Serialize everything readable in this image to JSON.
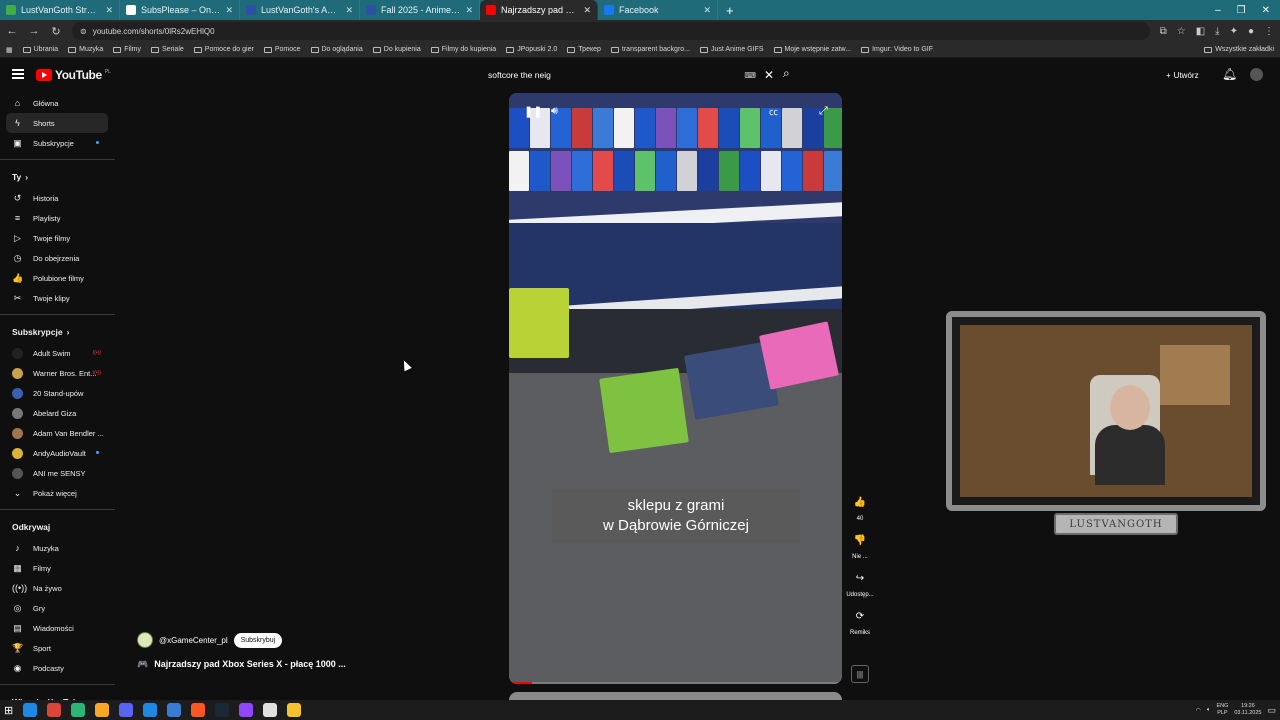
{
  "browser": {
    "tabs": [
      {
        "title": "LustVanGoth Stream - Watch L",
        "color": "#3fae49"
      },
      {
        "title": "SubsPlease – One stop shop fo",
        "color": "#ffffff"
      },
      {
        "title": "LustVanGoth's Anime List - My",
        "color": "#2e51a2"
      },
      {
        "title": "Fall 2025 - Anime - MyAnimeLi",
        "color": "#2e51a2"
      },
      {
        "title": "Najrzadszy pad Xbox Se",
        "color": "#ff0000",
        "active": true
      },
      {
        "title": "Facebook",
        "color": "#1877f2"
      }
    ],
    "new_tab": "+",
    "window_controls": [
      "–",
      "❐",
      "✕"
    ],
    "url": "youtube.com/shorts/0lRs2wEHlQ0",
    "bookmarks": [
      "Ubrania",
      "Muzyka",
      "Filmy",
      "Seriale",
      "Pomoce do gier",
      "Pomoce",
      "Do oglądania",
      "Do kupienia",
      "Filmy do kupienia",
      "JPopuski 2.0",
      "Трекер",
      "transparent backgro...",
      "Just Anime GIFS",
      "Moje wstępnie zatw...",
      "Imgur: Video to GIF"
    ],
    "bookmarks_right": "Wszystkie zakładki"
  },
  "youtube": {
    "logo": "YouTube",
    "country": "PL",
    "search_value": "softcore the neig",
    "create_label": "Utwórz"
  },
  "sidebar": {
    "main": [
      {
        "label": "Główna",
        "icon": "⌂"
      },
      {
        "label": "Shorts",
        "icon": "ϟ",
        "active": true
      },
      {
        "label": "Subskrypcje",
        "icon": "▣",
        "dot": true
      }
    ],
    "you_header": "Ty",
    "you": [
      {
        "label": "Historia",
        "icon": "↺"
      },
      {
        "label": "Playlisty",
        "icon": "≡"
      },
      {
        "label": "Twoje filmy",
        "icon": "▷"
      },
      {
        "label": "Do obejrzenia",
        "icon": "◷"
      },
      {
        "label": "Polubione filmy",
        "icon": "👍"
      },
      {
        "label": "Twoje klipy",
        "icon": "✂"
      }
    ],
    "subs_header": "Subskrypcje",
    "subs": [
      {
        "label": "Adult Swim",
        "color": "#222222",
        "badge": "live"
      },
      {
        "label": "Warner Bros. Ent...",
        "color": "#c9a34a",
        "badge": "live"
      },
      {
        "label": "20 Stand-upów",
        "color": "#3a5fb0"
      },
      {
        "label": "Abelard Giza",
        "color": "#777777"
      },
      {
        "label": "Adam Van Bendler ...",
        "color": "#a0754e"
      },
      {
        "label": "AndyAudioVault",
        "color": "#d9b23a",
        "badge": "dot"
      },
      {
        "label": "ANI me SENSY",
        "color": "#555555"
      }
    ],
    "show_more": "Pokaż więcej",
    "explore_header": "Odkrywaj",
    "explore": [
      {
        "label": "Muzyka",
        "icon": "♪"
      },
      {
        "label": "Filmy",
        "icon": "▦"
      },
      {
        "label": "Na żywo",
        "icon": "((•))"
      },
      {
        "label": "Gry",
        "icon": "◎"
      },
      {
        "label": "Wiadomości",
        "icon": "▤"
      },
      {
        "label": "Sport",
        "icon": "🏆"
      },
      {
        "label": "Podcasty",
        "icon": "◉"
      }
    ],
    "more_header": "Więcej z YouTube"
  },
  "short": {
    "caption_line1": "sklepu z grami",
    "caption_line2": "w Dąbrowie Górniczej",
    "channel": "@xGameCenter_pl",
    "subscribe_label": "Subskrybuj",
    "title_icon": "🎮",
    "title": "Najrzadszy pad Xbox Series X - płacę 1000 ...",
    "progress": 0.07,
    "actions": [
      {
        "name": "like",
        "icon": "👍",
        "label": "40"
      },
      {
        "name": "dislike",
        "icon": "👎",
        "label": "Nie ..."
      },
      {
        "name": "share",
        "icon": "↪",
        "label": "Udostęp..."
      },
      {
        "name": "remix",
        "icon": "⟳",
        "label": "Remiks"
      }
    ]
  },
  "webcam": {
    "badge": "LUSTVANGOTH"
  },
  "taskbar": {
    "icons": [
      "#1e88e5",
      "#db4437",
      "#2bb673",
      "#f9a825",
      "#5865f2",
      "#1e88e5",
      "#3a7bd5",
      "#ff5722",
      "#1b2838",
      "#9146ff",
      "#e0e0e0",
      "#f4c430"
    ],
    "lang": "ENG",
    "lang2": "PLP",
    "time": "19:26",
    "date": "03.11.2025"
  }
}
